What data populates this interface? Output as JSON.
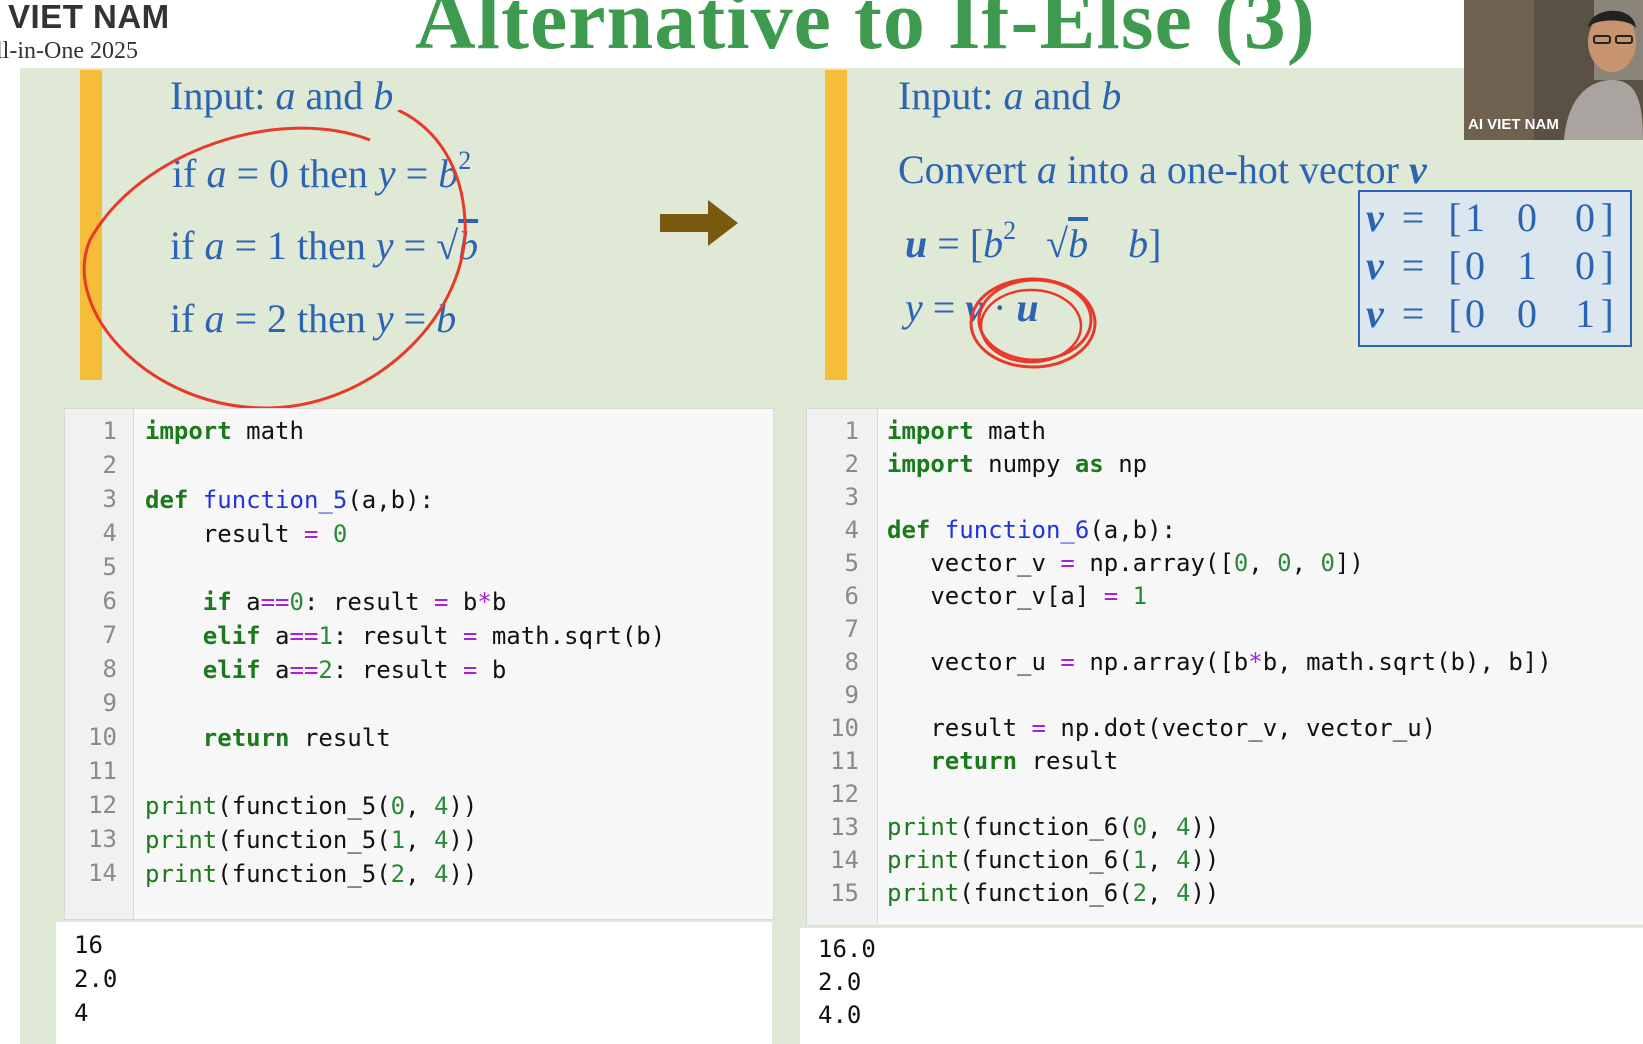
{
  "header": {
    "brand_line1": "VIET NAM",
    "brand_line2": "ll-in-One 2025",
    "title": "Alternative to If-Else (3)"
  },
  "left_math": {
    "input_prefix": "Input: ",
    "input_a": "a",
    "input_and": " and ",
    "input_b": "b",
    "if_word": "if ",
    "then_word": " then ",
    "rule1_cond": "= 0",
    "rule2_cond": "= 1",
    "rule3_cond": "= 2",
    "var_a": "a",
    "var_y": "y",
    "var_b": "b",
    "eq": "=",
    "sup2": "2",
    "sqrt": "√"
  },
  "right_math": {
    "input_prefix": "Input: ",
    "input_a": "a",
    "input_and": " and ",
    "input_b": "b",
    "convert_prefix": "Convert ",
    "convert_a": "a",
    "convert_mid": " into a one-hot vector ",
    "convert_v": "v",
    "u_label": "u",
    "y_label": "y",
    "v_label": "v",
    "dot": "·",
    "eq": "=",
    "u_open": "[",
    "u_close": "]",
    "u_b": "b",
    "sup2": "2",
    "sqrt": "√",
    "onehot_rows": [
      {
        "label": "v",
        "eq": "=",
        "open": "[",
        "c1": "1",
        "c2": "0",
        "c3": "0",
        "close": "]"
      },
      {
        "label": "v",
        "eq": "=",
        "open": "[",
        "c1": "0",
        "c2": "1",
        "c3": "0",
        "close": "]"
      },
      {
        "label": "v",
        "eq": "=",
        "open": "[",
        "c1": "0",
        "c2": "0",
        "c3": "1",
        "close": "]"
      }
    ]
  },
  "left_code": {
    "line_numbers": [
      "1",
      "2",
      "3",
      "4",
      "5",
      "6",
      "7",
      "8",
      "9",
      "10",
      "11",
      "12",
      "13",
      "14"
    ],
    "t": {
      "import": "import",
      "math": " math",
      "def": "def",
      "fname": " function_5",
      "params": "(a,b):",
      "result": "result",
      "eq": " = ",
      "zero": "0",
      "if": "if",
      "elif": "elif",
      "a": " a",
      "eqeq": "==",
      "n0": "0",
      "n1": "1",
      "n2": "2",
      "colon_result": ": result",
      "bstarb_b": "b",
      "star": "*",
      "bstarb_b2": "b",
      "sqrt_call": "math.sqrt(b)",
      "b": "b",
      "return": "return",
      "ret_result": " result",
      "print": "print",
      "call_open": "(function_5(",
      "comma4": ", ",
      "four": "4",
      "close": "))"
    },
    "output": [
      "16",
      "2.0",
      "4"
    ]
  },
  "right_code": {
    "line_numbers": [
      "1",
      "2",
      "3",
      "4",
      "5",
      "6",
      "7",
      "8",
      "9",
      "10",
      "11",
      "12",
      "13",
      "14",
      "15"
    ],
    "t": {
      "import": "import",
      "math": " math",
      "numpy": " numpy ",
      "as": "as",
      "np": " np",
      "def": "def",
      "fname": " function_6",
      "params": "(a,b):",
      "vector_v": "vector_v",
      "eq": " = ",
      "np_array_open": "np.array([",
      "z": "0",
      "comma": ", ",
      "arr_close": "])",
      "vector_v_idx": "vector_v[a]",
      "one": "1",
      "vector_u": "vector_u",
      "u_arr": "np.array([b",
      "star": "*",
      "u_rest": "b, math.sqrt(b), b])",
      "result": "result",
      "dot_call": "np.dot(vector_v, vector_u)",
      "return": "return",
      "ret_result": " result",
      "print": "print",
      "call_open": "(function_6(",
      "n0": "0",
      "n1": "1",
      "n2": "2",
      "comma4": ", ",
      "four": "4",
      "close": "))"
    },
    "output": [
      "16.0",
      "2.0",
      "4.0"
    ]
  },
  "webcam": {
    "label": "AI VIET NAM"
  },
  "colors": {
    "title_green": "#3e9a4e",
    "math_blue": "#2b64b3",
    "panel_bg": "#e0e9d5",
    "accent_bar": "#f5bd38",
    "annotation_red": "#e8392a",
    "arrow": "#7a5a10"
  }
}
